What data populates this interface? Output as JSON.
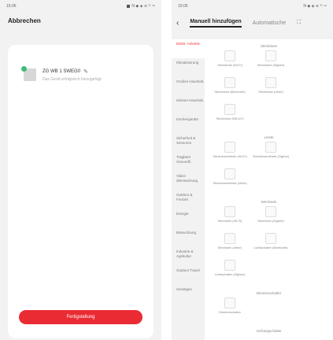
{
  "left": {
    "status_time": "15:06",
    "status_right": "N ◆ ◈ ≋ ᵀᴵ ⁴⁶",
    "topbar_cancel": "Abbrechen",
    "device_name": "ZG WB 1 SWEG0",
    "device_subtitle": "Das Gerät erfolgreich hinzugefügt",
    "done_button": "Fertigstellung",
    "check_color": "#3dbb7b",
    "accent_color": "#ea2b34"
  },
  "right": {
    "status_time": "15:06",
    "status_right": "N ◆ ◈ ≋ ᵀᴵ ⁴⁶",
    "tab_manual": "Manuell hinzufügen",
    "tab_auto": "Automatische",
    "sidebar": [
      "Elektr. Arbeitsk.",
      "Klimatisierung",
      "Großes Haushalt.",
      "Kleines Haushalt.",
      "Küchengeräte",
      "Sicherheit & Sensoren",
      "Tragbare Gesundh.",
      "Video-überwachung",
      "Outdoor & Freizeit",
      "Energie",
      "Beleuchtung",
      "Industrie & Agrikultur",
      "Outdoor Travel",
      "Sonstiges"
    ],
    "sections": [
      {
        "title": "Steckdose",
        "items": [
          "Steckdose (Wi-Fi)",
          "Steckdose (Zigbee)",
          "Steckdose (Bluetooth)",
          "Steckdose (other)",
          "Steckdose (NB-IoT)"
        ]
      },
      {
        "title": "Leiste",
        "items": [
          "Steckdosenleiste (Wi-Fi)",
          "Steckdosenleiste (Zigbee)",
          "Steckdosenleiste (other)"
        ]
      },
      {
        "title": "Wechseln",
        "items": [
          "Wechseln (Wi-Fi)",
          "Wechseln (Zigbee)",
          "Wechseln (other)",
          "Lichtschalter (Bluetooth)",
          "Lichtschalter (Zigbee)"
        ]
      },
      {
        "title": "Dimmerschalter",
        "items": [
          "Dimmerschalter"
        ]
      },
      {
        "title": "Vorhangschalter",
        "items": []
      }
    ]
  }
}
